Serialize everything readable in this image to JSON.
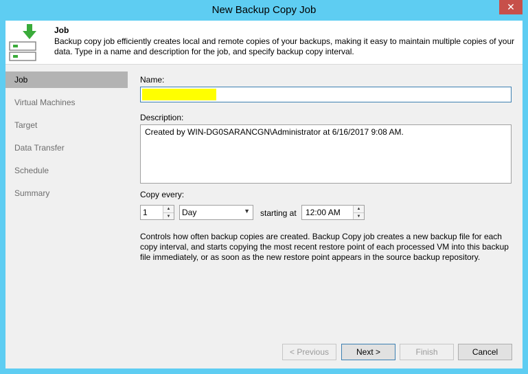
{
  "window": {
    "title": "New Backup Copy Job",
    "close_glyph": "✕"
  },
  "header": {
    "title": "Job",
    "description": "Backup copy job efficiently creates local and remote copies of your backups, making it easy to maintain multiple copies of your data. Type in a name and description for the job, and specify backup copy interval.",
    "icon": "backup-copy-job-icon"
  },
  "sidebar": {
    "items": [
      {
        "label": "Job",
        "active": true
      },
      {
        "label": "Virtual Machines",
        "active": false
      },
      {
        "label": "Target",
        "active": false
      },
      {
        "label": "Data Transfer",
        "active": false
      },
      {
        "label": "Schedule",
        "active": false
      },
      {
        "label": "Summary",
        "active": false
      }
    ]
  },
  "form": {
    "name_label": "Name:",
    "name_value": "",
    "description_label": "Description:",
    "description_value": "Created by WIN-DG0SARANCGN\\Administrator at 6/16/2017 9:08 AM.",
    "copy_every_label": "Copy every:",
    "interval_value": "1",
    "interval_unit": "Day",
    "starting_at_label": "starting at",
    "start_time": "12:00 AM",
    "info_text": "Controls how often backup copies are created. Backup Copy job creates a new backup file for each copy interval, and starts copying the most recent restore point of each processed VM into this backup file immediately, or as soon as the new restore point appears in the source backup repository."
  },
  "buttons": {
    "previous": "< Previous",
    "next": "Next >",
    "finish": "Finish",
    "cancel": "Cancel"
  },
  "colors": {
    "window_frame": "#5ecdf2",
    "close_button": "#c7504a",
    "highlight": "#ffff00",
    "icon_green": "#3aab3a"
  }
}
